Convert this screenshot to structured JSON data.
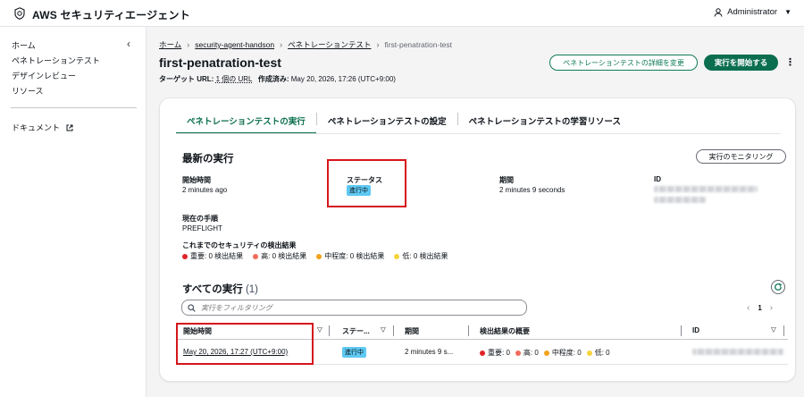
{
  "app": {
    "title": "AWS セキュリティエージェント",
    "user": "Administrator"
  },
  "sidebar": {
    "items": [
      {
        "label": "ホーム"
      },
      {
        "label": "ペネトレーションテスト"
      },
      {
        "label": "デザインレビュー"
      },
      {
        "label": "リソース"
      }
    ],
    "docs_label": "ドキュメント"
  },
  "breadcrumb": [
    "ホーム",
    "security-agent-handson",
    "ペネトレーションテスト",
    "first-penatration-test"
  ],
  "page": {
    "title": "first-penatration-test",
    "target_label": "ターゲット URL:",
    "target_value": "1 個の URL",
    "created_label": "作成済み:",
    "created_value": "May 20, 2026, 17:26 (UTC+9:00)",
    "edit_button": "ペネトレーションテストの詳細を変更",
    "start_button": "実行を開始する",
    "more_glyph": "⋮"
  },
  "tabs": [
    {
      "label": "ペネトレーションテストの実行",
      "active": true
    },
    {
      "label": "ペネトレーションテストの設定",
      "active": false
    },
    {
      "label": "ペネトレーションテストの学習リソース",
      "active": false
    }
  ],
  "latest_run": {
    "title": "最新の実行",
    "monitor_button": "実行のモニタリング",
    "start_time_label": "開始時間",
    "start_time_value": "2 minutes ago",
    "status_label": "ステータス",
    "status_value": "進行中",
    "duration_label": "期間",
    "duration_value": "2 minutes 9 seconds",
    "id_label": "ID",
    "current_step_label": "現在の手順",
    "current_step_value": "PREFLIGHT",
    "findings_label": "これまでのセキュリティの検出結果",
    "findings": [
      {
        "label": "重要: 0 検出結果",
        "color": "#e0242a"
      },
      {
        "label": "高: 0 検出結果",
        "color": "#f26b5b"
      },
      {
        "label": "中程度: 0 検出結果",
        "color": "#f2a21a"
      },
      {
        "label": "低: 0 検出結果",
        "color": "#f5d43a"
      }
    ]
  },
  "all_runs": {
    "title": "すべての実行",
    "count": "(1)",
    "filter_placeholder": "実行をフィルタリング",
    "page_number": "1",
    "columns": [
      "開始時間",
      "ステー...",
      "期間",
      "検出結果の概要",
      "ID"
    ],
    "rows": [
      {
        "start_time": "May 20, 2026, 17:27 (UTC+9:00)",
        "status": "進行中",
        "duration": "2 minutes 9 s...",
        "findings": [
          {
            "label": "重要: 0",
            "color": "#e0242a"
          },
          {
            "label": "高: 0",
            "color": "#f26b5b"
          },
          {
            "label": "中程度: 0",
            "color": "#f2a21a"
          },
          {
            "label": "低: 0",
            "color": "#f5d43a"
          }
        ]
      }
    ]
  },
  "colors": {
    "accent": "#0b6e4f",
    "badge": "#5ec9f2",
    "highlight": "#d6151b"
  }
}
